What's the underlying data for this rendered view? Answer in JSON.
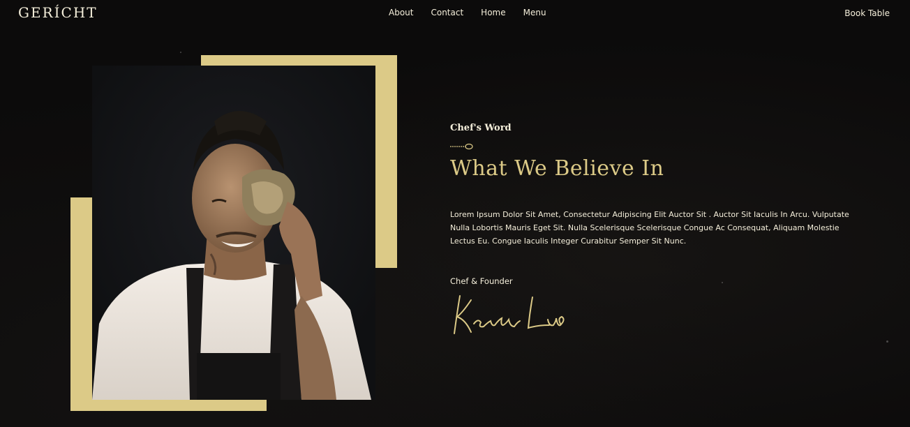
{
  "brand": {
    "logo": "GERÍCHT"
  },
  "nav": {
    "links": [
      "About",
      "Contact",
      "Home",
      "Menu"
    ],
    "cta": "Book Table"
  },
  "about": {
    "subtitle": "Chef's Word",
    "headline": "What We Believe In",
    "body": "Lorem Ipsum Dolor Sit Amet, Consectetur Adipiscing Elit Auctor Sit . Auctor Sit Iaculis In Arcu. Vulputate Nulla Lobortis Mauris Eget Sit. Nulla Scelerisque Scelerisque Congue Ac Consequat, Aliquam Molestie Lectus Eu. Congue Iaculis Integer Curabitur Semper Sit Nunc.",
    "role": "Chef & Founder",
    "signature": "Kevin Luo"
  },
  "colors": {
    "gold": "#dcca87",
    "cream": "#f5efdb",
    "background": "#0c0b0b"
  },
  "icons": {
    "spoon": "spoon-icon",
    "signature": "signature-icon"
  }
}
